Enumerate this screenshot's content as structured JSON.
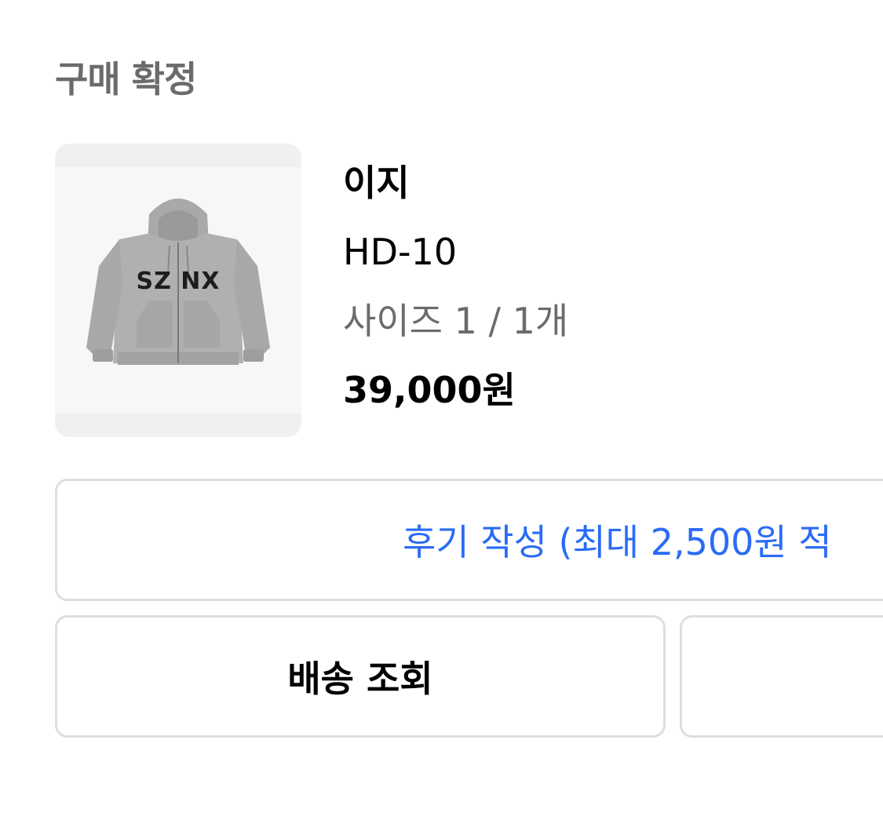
{
  "order": {
    "status": "구매 확정"
  },
  "product": {
    "brand": "이지",
    "model": "HD-10",
    "option": "사이즈 1 / 1개",
    "price": "39,000원",
    "image_text": "SZ NX"
  },
  "actions": {
    "review_label": "후기 작성 (최대 2,500원 적",
    "track_label": "배송 조회",
    "other_label": ""
  },
  "colors": {
    "review_text": "#2a6cf6",
    "border": "#dedede",
    "muted_text": "#6b6b6b"
  }
}
